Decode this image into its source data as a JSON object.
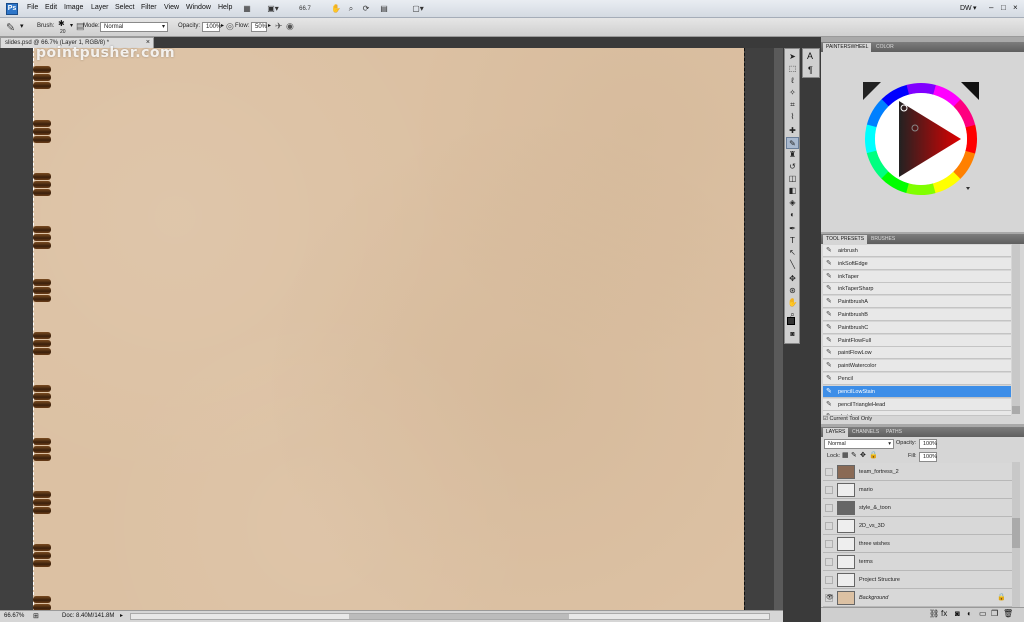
{
  "app": {
    "logo": "Ps"
  },
  "menu": [
    "File",
    "Edit",
    "Image",
    "Layer",
    "Select",
    "Filter",
    "View",
    "Window",
    "Help"
  ],
  "menubar": {
    "zoom_value": "66.7",
    "workspace": "DW",
    "window_controls": [
      "–",
      "□",
      "×"
    ]
  },
  "options": {
    "brush_label": "Brush:",
    "brush_size": "20",
    "mode_label": "Mode:",
    "mode_value": "Normal",
    "opacity_label": "Opacity:",
    "opacity_value": "100%",
    "flow_label": "Flow:",
    "flow_value": "50%"
  },
  "document": {
    "tab_title": "slides.psd @ 66.7% (Layer 1, RGB/8) *",
    "close": "×",
    "watermark": "pointpusher.com"
  },
  "status": {
    "zoom": "66.67%",
    "doc": "Doc: 8.40M/141.8M"
  },
  "color_panel": {
    "tabs": [
      "PAINTERSWHEEL",
      "COLOR"
    ],
    "swatches": [
      "#111111",
      "#444444",
      "#777777",
      "#aaaaaa",
      "#cccccc",
      "#ffffff"
    ]
  },
  "presets_panel": {
    "tabs": [
      "TOOL PRESETS",
      "BRUSHES"
    ],
    "items": [
      "airbrush",
      "inkSoftEdge",
      "inkTaper",
      "inkTaperSharp",
      "PaintbrushA",
      "PaintbrushB",
      "PaintbrushC",
      "PaintFlowFull",
      "paintFlowLow",
      "paintWatercolor",
      "Pencil",
      "pencilLowStain",
      "pencilTriangleHead",
      "sketch"
    ],
    "selected_index": 11,
    "current_tool_only": "Current Tool Only"
  },
  "layers_panel": {
    "tabs": [
      "LAYERS",
      "CHANNELS",
      "PATHS"
    ],
    "blend_mode": "Normal",
    "opacity_label": "Opacity:",
    "opacity_value": "100%",
    "lock_label": "Lock:",
    "fill_label": "Fill:",
    "fill_value": "100%",
    "layers": [
      {
        "name": "team_fortress_2"
      },
      {
        "name": "mario"
      },
      {
        "name": "style_&_toon"
      },
      {
        "name": "2D_vs_3D"
      },
      {
        "name": "three wishes"
      },
      {
        "name": "terms"
      },
      {
        "name": "Project Structure"
      },
      {
        "name": "Background"
      }
    ]
  }
}
